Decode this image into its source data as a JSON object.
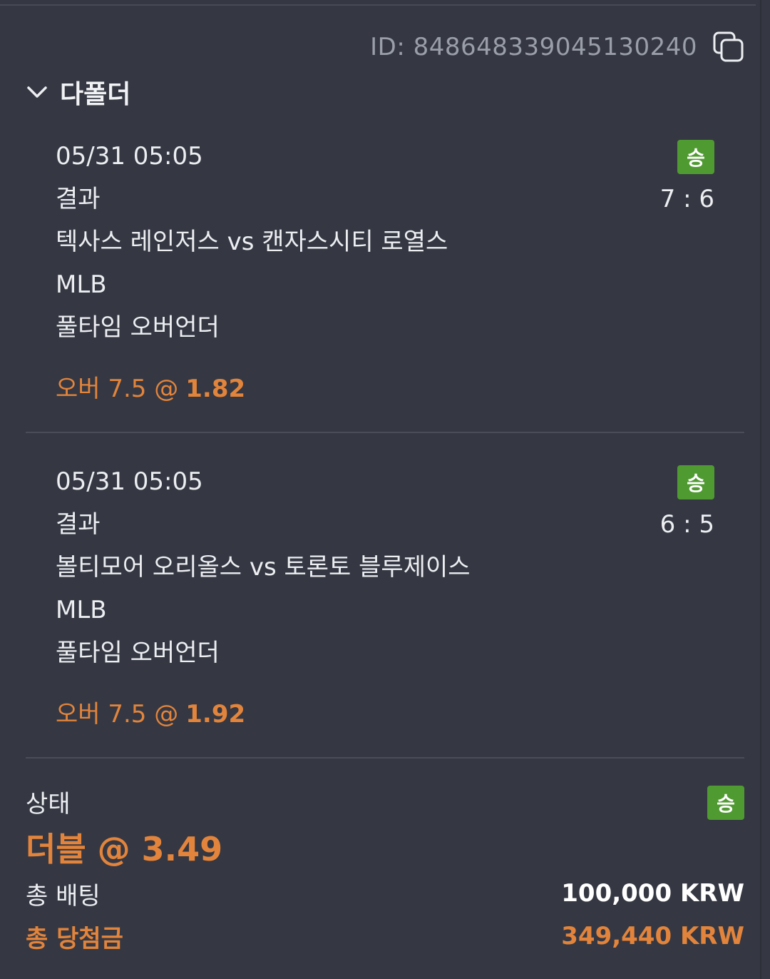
{
  "ticket": {
    "id_text": "ID: 848648339045130240",
    "copy_icon": "copy-icon"
  },
  "folder": {
    "title": "다폴더",
    "toggle_icon": "chevron-down-icon"
  },
  "bets": [
    {
      "datetime": "05/31 05:05",
      "status_badge": "승",
      "market_label": "결과",
      "score": "7 : 6",
      "match": "텍사스 레인저스 vs 캔자스시티 로열스",
      "league": "MLB",
      "bet_type": "풀타임 오버언더",
      "pick": "오버 7.5 @",
      "odds": "1.82"
    },
    {
      "datetime": "05/31 05:05",
      "status_badge": "승",
      "market_label": "결과",
      "score": "6 : 5",
      "match": "볼티모어 오리올스 vs 토론토 블루제이스",
      "league": "MLB",
      "bet_type": "풀타임 오버언더",
      "pick": "오버 7.5 @",
      "odds": "1.92"
    }
  ],
  "summary": {
    "status_label": "상태",
    "status_badge": "승",
    "combo_title": "더블 @ 3.49",
    "total_bet_label": "총 배팅",
    "total_bet_value": "100,000 KRW",
    "total_win_label": "총 당첨금",
    "total_win_value": "349,440 KRW"
  },
  "colors": {
    "background": "#353842",
    "accent_orange": "#e2843c",
    "win_green": "#4f9a31",
    "muted_text": "#9a9ea8"
  }
}
